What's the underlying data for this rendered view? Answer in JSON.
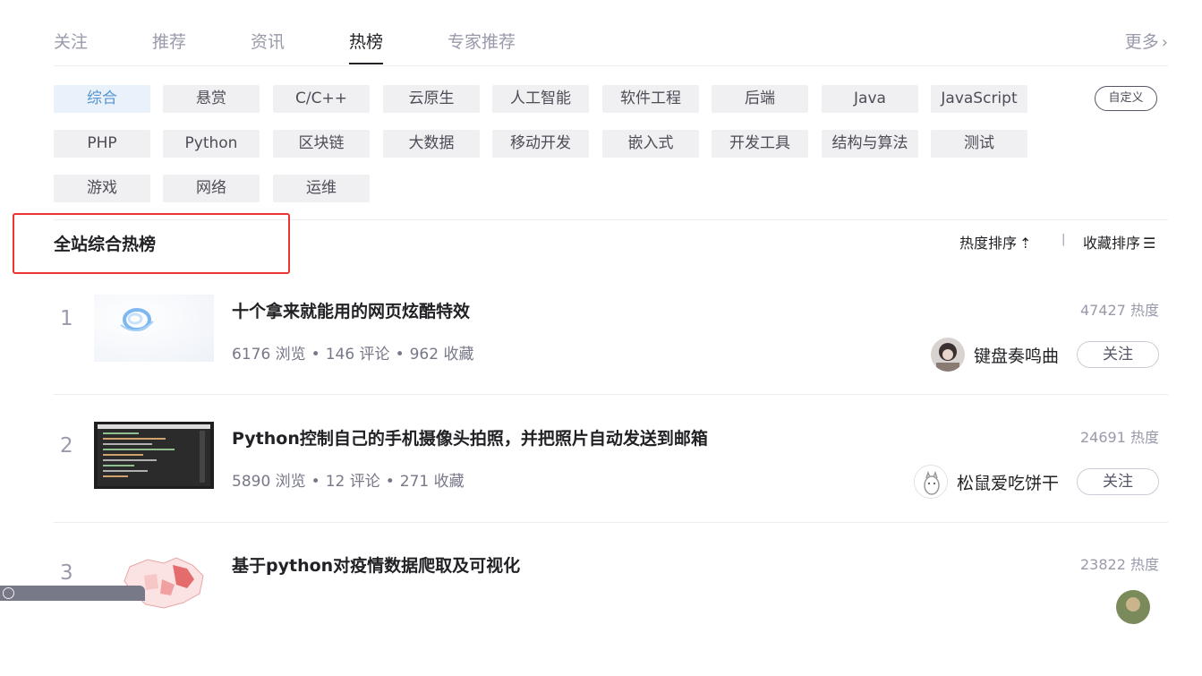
{
  "tabs": [
    {
      "label": "关注"
    },
    {
      "label": "推荐"
    },
    {
      "label": "资讯"
    },
    {
      "label": "热榜",
      "active": true
    },
    {
      "label": "专家推荐"
    }
  ],
  "more_label": "更多",
  "categories": [
    [
      "综合",
      "悬赏",
      "C/C++",
      "云原生",
      "人工智能",
      "软件工程",
      "后端",
      "Java",
      "JavaScript"
    ],
    [
      "PHP",
      "Python",
      "区块链",
      "大数据",
      "移动开发",
      "嵌入式",
      "开发工具",
      "结构与算法",
      "测试"
    ],
    [
      "游戏",
      "网络",
      "运维"
    ]
  ],
  "active_category": "综合",
  "custom_label": "自定义",
  "section_title": "全站综合热榜",
  "sort": {
    "heat_label": "热度排序",
    "fav_label": "收藏排序",
    "separator": "|"
  },
  "articles": [
    {
      "rank": "1",
      "title": "十个拿来就能用的网页炫酷特效",
      "views": "6176 浏览",
      "comments": "146 评论",
      "favorites": "962 收藏",
      "heat": "47427 热度",
      "author": "键盘奏鸣曲",
      "follow_label": "关注"
    },
    {
      "rank": "2",
      "title": "Python控制自己的手机摄像头拍照，并把照片自动发送到邮箱",
      "views": "5890 浏览",
      "comments": "12 评论",
      "favorites": "271 收藏",
      "heat": "24691 热度",
      "author": "松鼠爱吃饼干",
      "follow_label": "关注"
    },
    {
      "rank": "3",
      "title": "基于python对疫情数据爬取及可视化",
      "views": "",
      "comments": "",
      "favorites": "",
      "heat": "23822 热度",
      "author": "",
      "follow_label": ""
    }
  ],
  "icons": {
    "more": "chevron-right-icon",
    "heat_sort": "sort-ascending-icon",
    "fav_sort": "sort-lines-icon"
  },
  "colors": {
    "active_chip_bg": "#e9f2fb",
    "active_chip_text": "#5794d0",
    "highlight_box": "#ee3333"
  }
}
